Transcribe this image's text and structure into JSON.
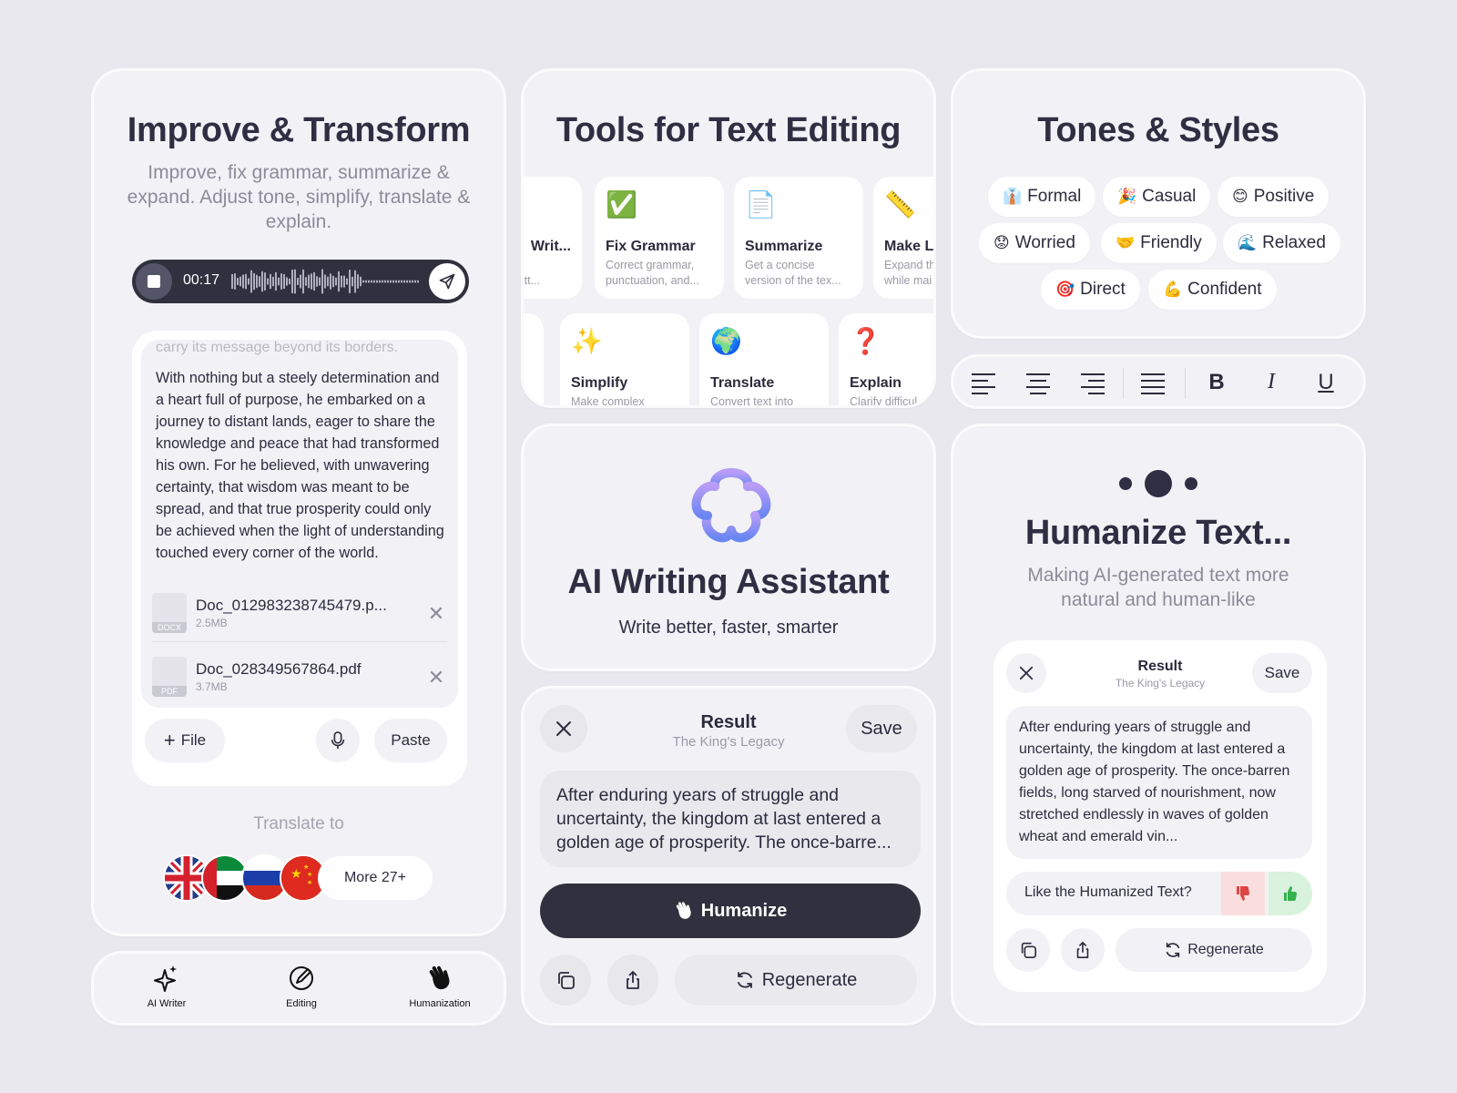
{
  "colors": {
    "background": "#e9e8ee",
    "card": "#f2f2f6",
    "dark": "#30303f",
    "accent": "#8a7cf3"
  },
  "improve": {
    "title": "Improve & Transform",
    "subtitle": "Improve, fix grammar, summarize & expand. Adjust tone, simplify, translate & explain.",
    "recorder": {
      "time": "00:17"
    },
    "text_fade": "carry its message beyond its borders.",
    "text": "With nothing but a steely determination and a heart full of purpose, he embarked on a journey to distant lands, eager to share the knowledge and peace that had transformed his own. For he believed, with unwavering certainty, that wisdom was meant to be spread, and that true prosperity could only be achieved when the light of understanding touched every corner of the world.",
    "files": [
      {
        "name": "Doc_012983238745479.p...",
        "size": "2.5MB",
        "type": "DOCX"
      },
      {
        "name": "Doc_028349567864.pdf",
        "size": "3.7MB",
        "type": "PDF"
      }
    ],
    "file_button": "File",
    "paste_button": "Paste",
    "translate_label": "Translate to",
    "more_languages": "More 27+"
  },
  "nav": {
    "items": [
      "AI Writer",
      "Editing",
      "Humanization"
    ]
  },
  "tools": {
    "title": "Tools for Text Editing",
    "row1": [
      {
        "icon": "",
        "name": "Writ...",
        "desc1": "larity",
        "desc2": "or bett..."
      },
      {
        "icon": "✅",
        "name": "Fix Grammar",
        "desc1": "Correct grammar,",
        "desc2": "punctuation, and..."
      },
      {
        "icon": "📄",
        "name": "Summarize",
        "desc1": "Get a concise",
        "desc2": "version of the tex..."
      },
      {
        "icon": "📏",
        "name": "Make Lo",
        "desc1": "Expand th",
        "desc2": "while mai"
      }
    ],
    "row2": [
      {
        "icon": "✨",
        "name": "Simplify",
        "desc1": "Make complex"
      },
      {
        "icon": "🌍",
        "name": "Translate",
        "desc1": "Convert text into"
      },
      {
        "icon": "❓",
        "name": "Explain",
        "desc1": "Clarify difficul"
      }
    ]
  },
  "assistant": {
    "title": "AI Writing Assistant",
    "subtitle": "Write better, faster, smarter"
  },
  "result_mid": {
    "title": "Result",
    "subtitle": "The King's Legacy",
    "save": "Save",
    "text": "After enduring years of struggle and uncertainty, the kingdom at last entered a golden age of prosperity. The once-barre...",
    "humanize": "Humanize",
    "regenerate": "Regenerate"
  },
  "tones": {
    "title": "Tones & Styles",
    "items": [
      {
        "emoji": "👔",
        "label": "Formal"
      },
      {
        "emoji": "🎉",
        "label": "Casual"
      },
      {
        "emoji": "😊",
        "label": "Positive"
      },
      {
        "emoji": "😟",
        "label": "Worried"
      },
      {
        "emoji": "🤝",
        "label": "Friendly"
      },
      {
        "emoji": "🌊",
        "label": "Relaxed"
      },
      {
        "emoji": "🎯",
        "label": "Direct"
      },
      {
        "emoji": "💪",
        "label": "Confident"
      }
    ]
  },
  "format": {
    "bold": "B",
    "italic": "I",
    "underline": "U"
  },
  "humanize": {
    "title": "Humanize Text...",
    "subtitle": "Making AI-generated text more natural and human-like",
    "result_title": "Result",
    "result_subtitle": "The King's Legacy",
    "save": "Save",
    "text": "After enduring years of struggle and uncertainty, the kingdom at last entered a golden age of prosperity. The once-barren fields, long starved of nourishment, now stretched endlessly in waves of golden wheat and emerald vin...",
    "feedback": "Like the Humanized Text?",
    "regenerate": "Regenerate"
  }
}
